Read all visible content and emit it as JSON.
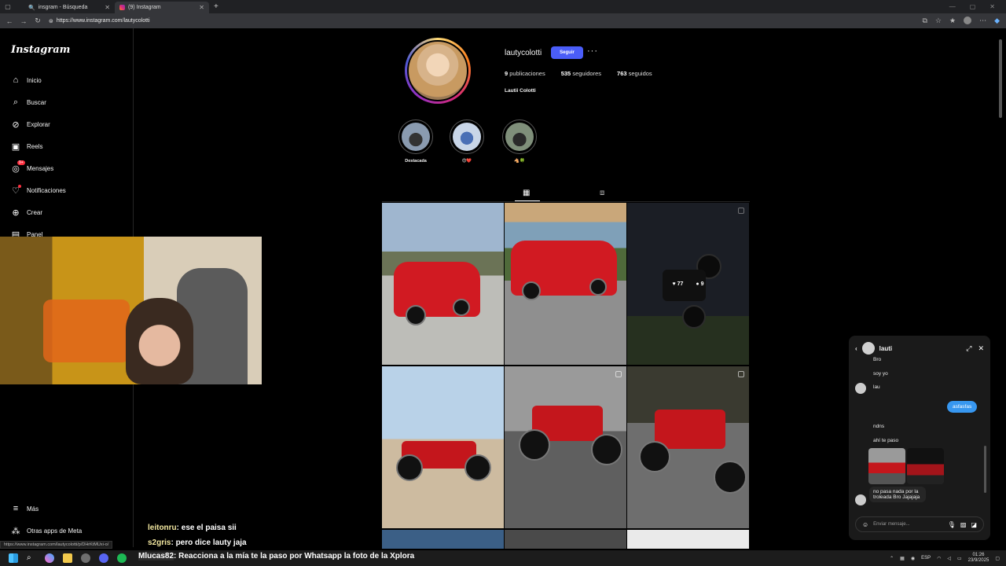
{
  "browser": {
    "tabs": [
      {
        "title": "insgram - Búsqueda"
      },
      {
        "title": "(9) Instagram"
      }
    ],
    "url": "https://www.instagram.com/lautycolotti",
    "status_url": "https://www.instagram.com/lautycolotti/p/DHrKtMUxi-o/"
  },
  "sidebar": {
    "logo": "Instagram",
    "items": [
      {
        "label": "Inicio",
        "icon": "home-icon"
      },
      {
        "label": "Buscar",
        "icon": "search-icon"
      },
      {
        "label": "Explorar",
        "icon": "compass-icon"
      },
      {
        "label": "Reels",
        "icon": "reels-icon"
      },
      {
        "label": "Mensajes",
        "icon": "messenger-icon",
        "badge": "9+"
      },
      {
        "label": "Notificaciones",
        "icon": "heart-icon"
      },
      {
        "label": "Crear",
        "icon": "plus-icon"
      },
      {
        "label": "Panel",
        "icon": "panel-icon"
      }
    ],
    "more": "Más",
    "meta": "Otras apps de Meta"
  },
  "profile": {
    "username": "lautycolotti",
    "follow": "Seguir",
    "more": "···",
    "posts_count": "9",
    "posts_label": "publicaciones",
    "followers_count": "535",
    "followers_label": "seguidores",
    "following_count": "763",
    "following_label": "seguidos",
    "full_name": "Lautii Colotti"
  },
  "highlights": [
    {
      "label": "Destacada"
    },
    {
      "label": "😍❤️"
    },
    {
      "label": "🐴🍀"
    }
  ],
  "post_hover": {
    "likes": "77",
    "comments": "9"
  },
  "stream_chat": [
    {
      "user": "leitonru",
      "text": ": ese el paisa sii"
    },
    {
      "user": "s2gris",
      "text": ": pero dice lauty jaja"
    }
  ],
  "stream_notification": {
    "user": "Mlucas82",
    "text": ": Reacciona a la mía te la paso por Whatsapp la foto de la Xplora"
  },
  "dm": {
    "name": "lauti",
    "messages": [
      {
        "text": "Bro"
      },
      {
        "text": "soy yo"
      },
      {
        "text": "lau"
      },
      {
        "text": "asfasfas"
      },
      {
        "text": "ndns"
      },
      {
        "text": "ahí te paso"
      },
      {
        "text": "no pasa nada por la troleada Bro Jajajaja"
      }
    ],
    "placeholder": "Enviar mensaje..."
  },
  "taskbar": {
    "lang": "ESP",
    "time": "01:26",
    "date": "23/9/2025"
  }
}
